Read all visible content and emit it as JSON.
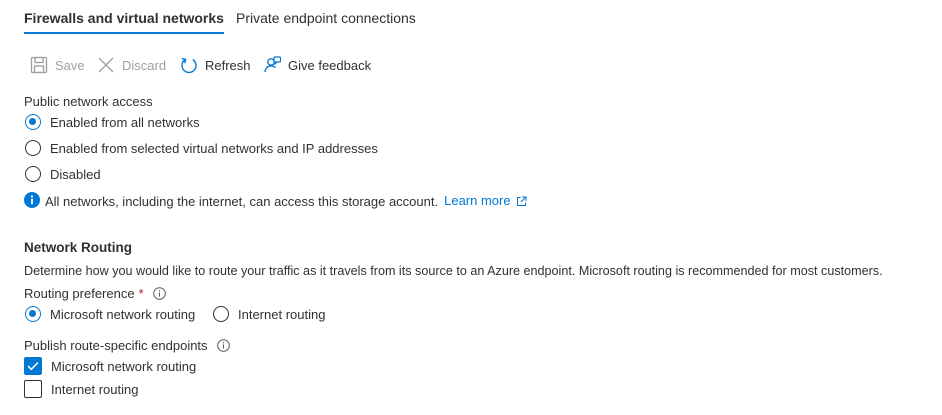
{
  "tabs": [
    {
      "label": "Firewalls and virtual networks",
      "active": true
    },
    {
      "label": "Private endpoint connections",
      "active": false
    }
  ],
  "toolbar": {
    "save_label": "Save",
    "discard_label": "Discard",
    "refresh_label": "Refresh",
    "feedback_label": "Give feedback"
  },
  "public_access": {
    "label": "Public network access",
    "options": [
      {
        "label": "Enabled from all networks",
        "checked": true
      },
      {
        "label": "Enabled from selected virtual networks and IP addresses",
        "checked": false
      },
      {
        "label": "Disabled",
        "checked": false
      }
    ],
    "info_text": "All networks, including the internet, can access this storage account.",
    "learn_more": "Learn more"
  },
  "routing": {
    "title": "Network Routing",
    "description": "Determine how you would like to route your traffic as it travels from its source to an Azure endpoint. Microsoft routing is recommended for most customers.",
    "preference_label": "Routing preference",
    "required_marker": "*",
    "preference_options": [
      {
        "label": "Microsoft network routing",
        "checked": true
      },
      {
        "label": "Internet routing",
        "checked": false
      }
    ],
    "publish_label": "Publish route-specific endpoints",
    "publish_options": [
      {
        "label": "Microsoft network routing",
        "checked": true
      },
      {
        "label": "Internet routing",
        "checked": false
      }
    ]
  },
  "colors": {
    "accent": "#0078d4",
    "text": "#323130",
    "disabled": "#a19f9d",
    "required": "#a4262c"
  }
}
